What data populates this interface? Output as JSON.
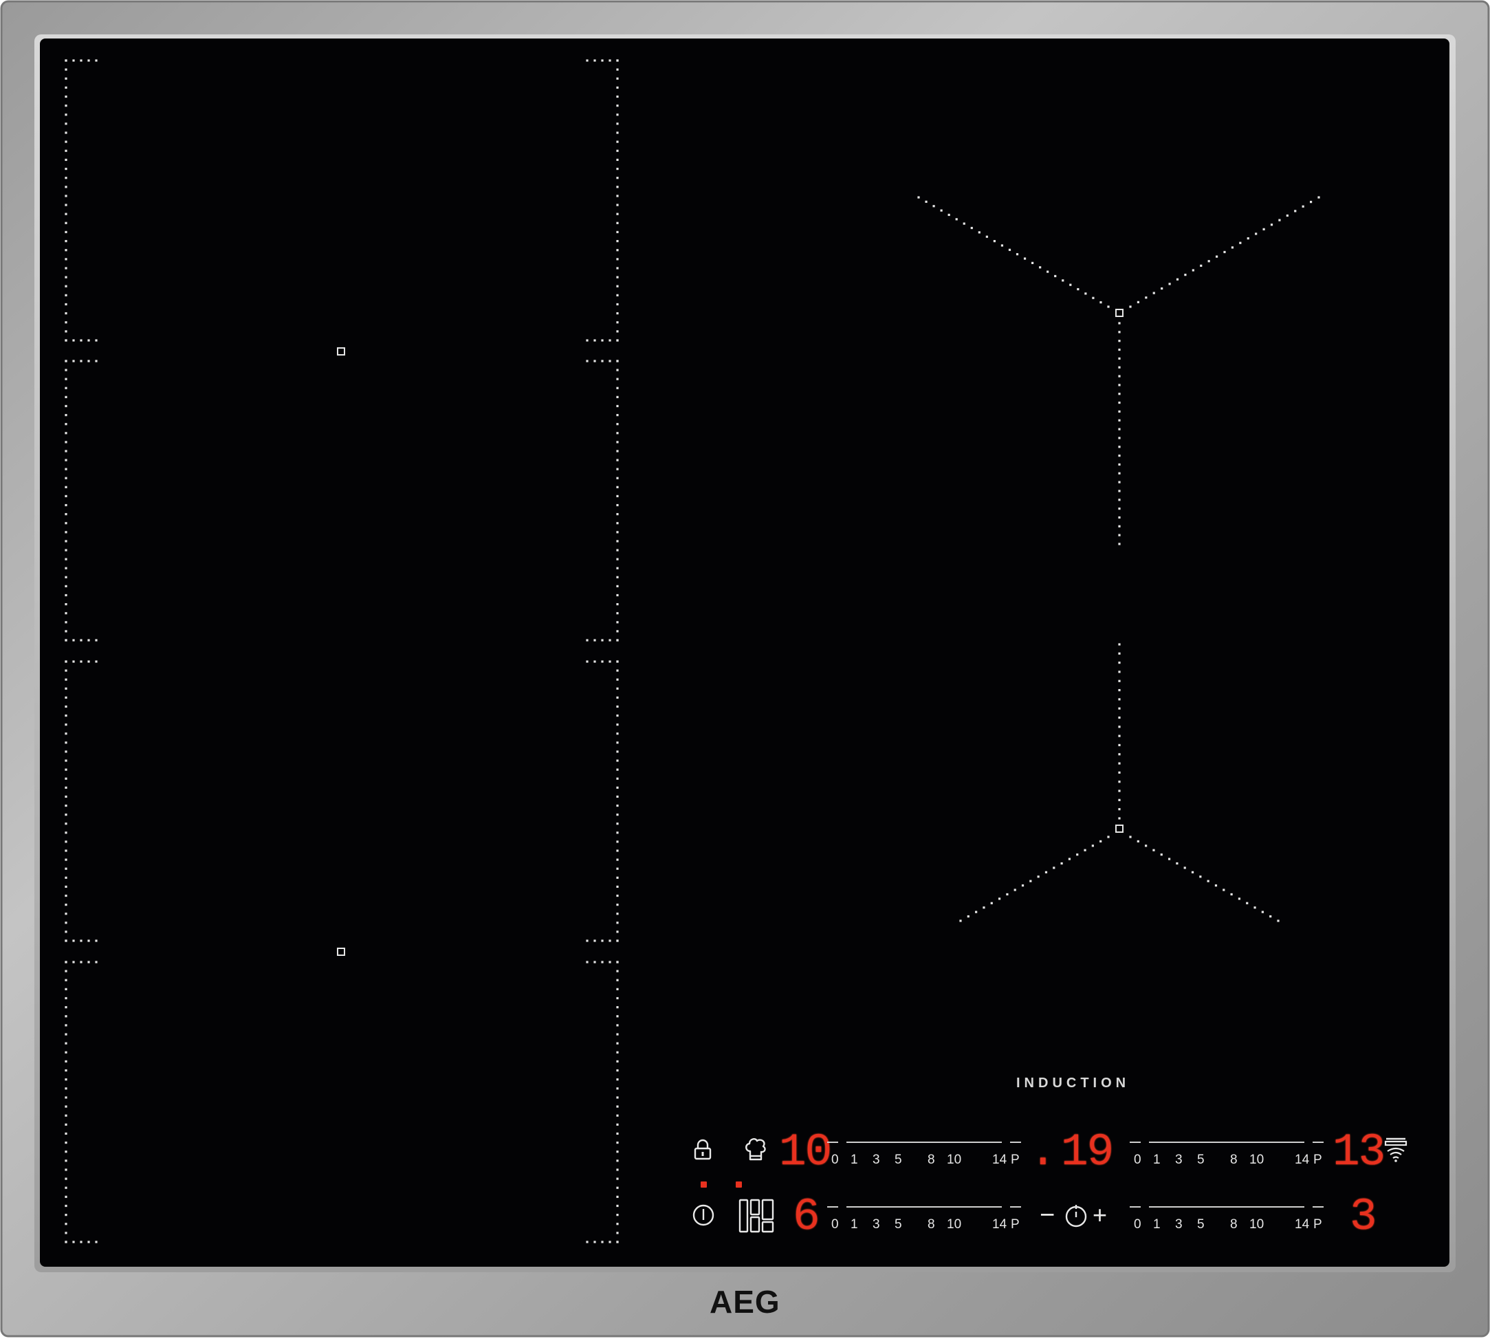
{
  "brand": "AEG",
  "label": "INDUCTION",
  "colors": {
    "frame": "#a8a8a8",
    "glass": "#030305",
    "led": "#e8311f",
    "marking": "#e6e6e6"
  },
  "displays": {
    "top_left_zone": "10",
    "timer_dot": ".",
    "timer": "19",
    "top_right_zone": "13",
    "bottom_left_zone": "6",
    "bottom_right_zone": "3"
  },
  "slider_scale": [
    "0",
    "1",
    "3",
    "5",
    "8",
    "10",
    "14",
    "P"
  ],
  "timer_controls": {
    "minus": "−",
    "plus": "+"
  },
  "icons": {
    "lock": "lock-icon",
    "chef": "chef-hat-icon",
    "power": "power-icon",
    "bridge": "bridge-zones-icon",
    "timer": "timer-icon",
    "hood": "hob2hood-icon"
  }
}
